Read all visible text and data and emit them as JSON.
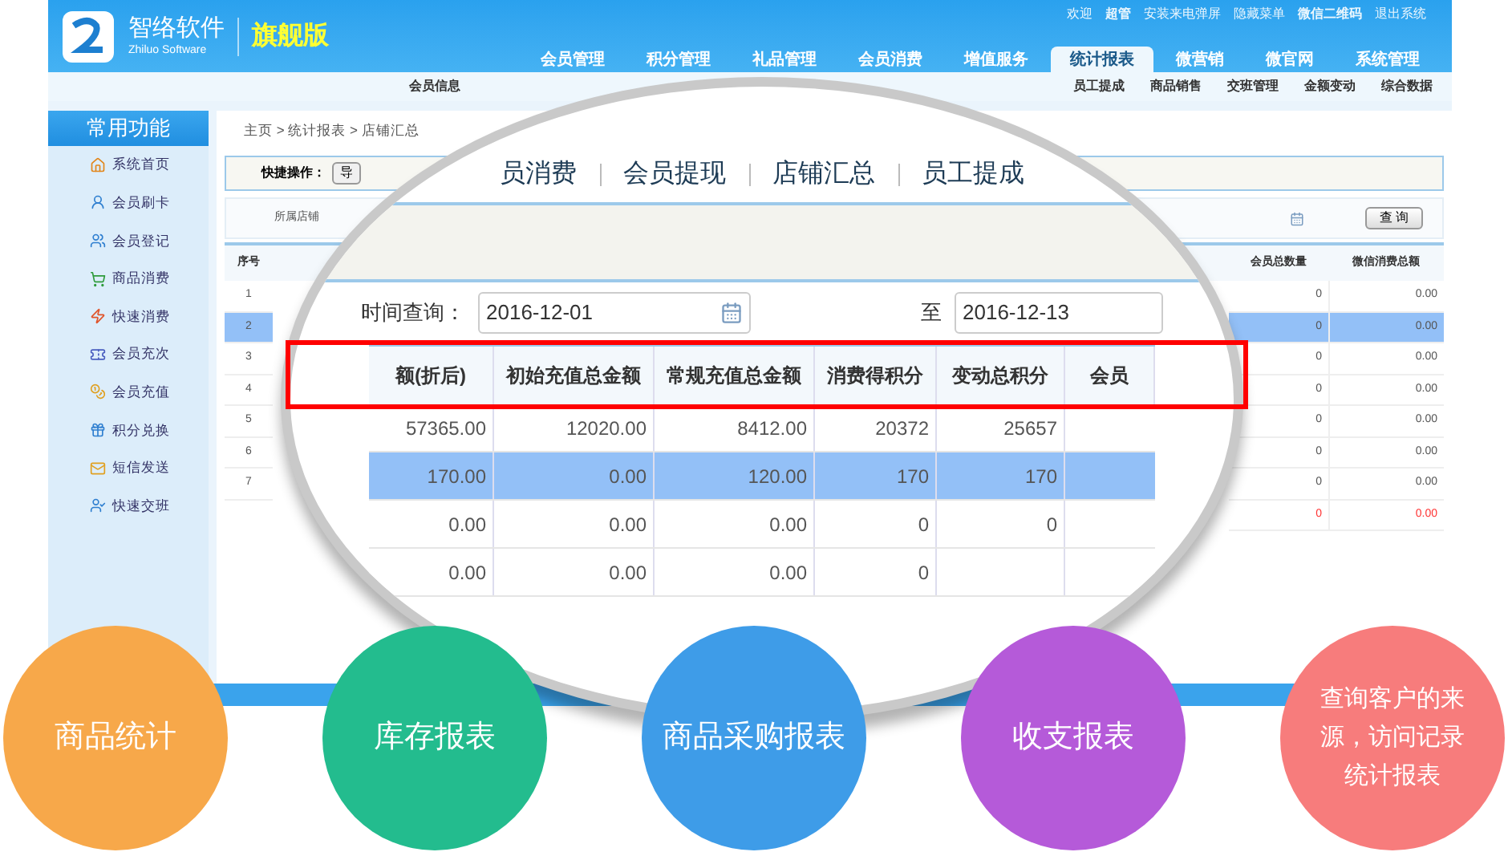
{
  "header": {
    "brand": "智络软件",
    "brand_en": "Zhiluo Software",
    "edition": "旗舰版",
    "top_links": [
      {
        "label": "欢迎",
        "bold": false
      },
      {
        "label": "超管",
        "bold": true
      },
      {
        "label": "安装来电弹屏",
        "bold": false
      },
      {
        "label": "隐藏菜单",
        "bold": false
      },
      {
        "label": "微信二维码",
        "bold": true
      },
      {
        "label": "退出系统",
        "bold": false
      }
    ],
    "nav": [
      {
        "label": "会员管理",
        "selected": false
      },
      {
        "label": "积分管理",
        "selected": false
      },
      {
        "label": "礼品管理",
        "selected": false
      },
      {
        "label": "会员消费",
        "selected": false
      },
      {
        "label": "增值服务",
        "selected": false
      },
      {
        "label": "统计报表",
        "selected": true
      },
      {
        "label": "微营销",
        "selected": false
      },
      {
        "label": "微官网",
        "selected": false
      },
      {
        "label": "系统管理",
        "selected": false
      }
    ],
    "subnav": [
      "会员信息",
      "员工提成",
      "商品销售",
      "交班管理",
      "金额变动",
      "综合数据"
    ]
  },
  "sidebar": {
    "title": "常用功能",
    "items": [
      "系统首页",
      "会员刷卡",
      "会员登记",
      "商品消费",
      "快速消费",
      "会员充次",
      "会员充值",
      "积分兑换",
      "短信发送",
      "快速交班"
    ]
  },
  "content": {
    "breadcrumb": "主页 > 统计报表 > 店铺汇总",
    "quick_ops": {
      "label": "快捷操作：",
      "button": "导"
    },
    "filter": {
      "label": "所属店铺",
      "button": "查 询"
    },
    "table": {
      "columns": [
        "序号",
        "会员总数量",
        "微信消费总额"
      ],
      "rows": [
        {
          "kind": "normal",
          "index": "1",
          "count": "0",
          "amount": "0.00",
          "selected": false
        },
        {
          "kind": "normal",
          "index": "2",
          "count": "0",
          "amount": "0.00",
          "selected": true
        },
        {
          "kind": "normal",
          "index": "3",
          "count": "0",
          "amount": "0.00",
          "selected": false
        },
        {
          "kind": "normal",
          "index": "4",
          "count": "0",
          "amount": "0.00",
          "selected": false
        },
        {
          "kind": "normal",
          "index": "5",
          "count": "0",
          "amount": "0.00",
          "selected": false
        },
        {
          "kind": "normal",
          "index": "6",
          "count": "0",
          "amount": "0.00",
          "selected": false
        },
        {
          "kind": "normal",
          "index": "7",
          "count": "0",
          "amount": "0.00",
          "selected": false
        },
        {
          "kind": "total",
          "index": "",
          "count": "0",
          "amount": "0.00",
          "selected": false
        }
      ]
    }
  },
  "magnifier": {
    "tabs": [
      "员消费",
      "会员提现",
      "店铺汇总",
      "员工提成"
    ],
    "date": {
      "label": "时间查询：",
      "from": "2016-12-01",
      "separator": "至",
      "to": "2016-12-13"
    },
    "table": {
      "columns": [
        "额(折后)",
        "初始充值总金额",
        "常规充值总金额",
        "消费得积分",
        "变动总积分",
        "会员"
      ],
      "rows": [
        {
          "cells": [
            "57365.00",
            "12020.00",
            "8412.00",
            "20372",
            "25657"
          ],
          "selected": false
        },
        {
          "cells": [
            "170.00",
            "0.00",
            "120.00",
            "170",
            "170"
          ],
          "selected": true
        },
        {
          "cells": [
            "0.00",
            "0.00",
            "0.00",
            "0",
            "0"
          ],
          "selected": false
        },
        {
          "cells": [
            "0.00",
            "0.00",
            "0.00",
            "0",
            ""
          ],
          "selected": false
        }
      ]
    }
  },
  "features": [
    {
      "label": "商品统计",
      "color": "#f7a84a"
    },
    {
      "label": "库存报表",
      "color": "#23bc8e"
    },
    {
      "label": "商品采购报表",
      "color": "#3e9ce8"
    },
    {
      "label": "收支报表",
      "color": "#b55ad9"
    },
    {
      "label": "查询客户的来源，访问记录统计报表",
      "color": "#f77c7c"
    }
  ]
}
